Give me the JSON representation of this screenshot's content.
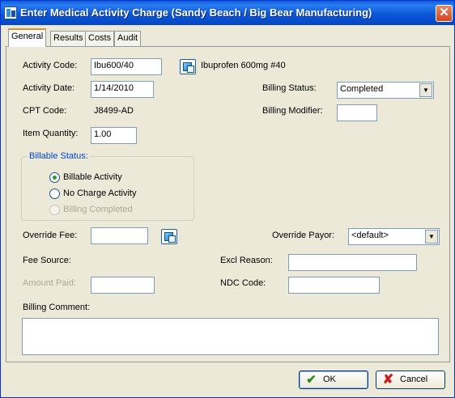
{
  "window": {
    "title": "Enter Medical Activity Charge (Sandy Beach / Big Bear Manufacturing)",
    "close_glyph": "✕"
  },
  "tabs": [
    {
      "label": "General",
      "active": true
    },
    {
      "label": "Results",
      "active": false
    },
    {
      "label": "Costs",
      "active": false
    },
    {
      "label": "Audit",
      "active": false
    }
  ],
  "general": {
    "activity_code_label": "Activity Code:",
    "activity_code_value": "Ibu600/40",
    "activity_code_description": "Ibuprofen 600mg #40",
    "activity_date_label": "Activity Date:",
    "activity_date_value": "1/14/2010",
    "cpt_code_label": "CPT Code:",
    "cpt_code_value": "J8499-AD",
    "item_quantity_label": "Item Quantity:",
    "item_quantity_value": "1.00",
    "billing_status_label": "Billing Status:",
    "billing_status_value": "Completed",
    "billing_modifier_label": "Billing Modifier:",
    "billing_modifier_value": "",
    "billable_status": {
      "title": "Billable Status:",
      "options": [
        {
          "label": "Billable Activity",
          "selected": true,
          "enabled": true
        },
        {
          "label": "No Charge Activity",
          "selected": false,
          "enabled": true
        },
        {
          "label": "Billing Completed",
          "selected": false,
          "enabled": false
        }
      ]
    },
    "override_fee_label": "Override Fee:",
    "override_fee_value": "",
    "override_payor_label": "Override Payor:",
    "override_payor_value": "<default>",
    "fee_source_label": "Fee Source:",
    "excl_reason_label": "Excl Reason:",
    "excl_reason_value": "",
    "amount_paid_label": "Amount Paid:",
    "amount_paid_value": "",
    "ndc_code_label": "NDC Code:",
    "ndc_code_value": "",
    "billing_comment_label": "Billing Comment:",
    "billing_comment_value": ""
  },
  "buttons": {
    "ok_label": "OK",
    "cancel_label": "Cancel"
  },
  "colors": {
    "title_bar": "#0b58d6",
    "group_title": "#0046d5",
    "selected_radio": "#21a121"
  },
  "icons": {
    "close": "close-icon",
    "activity_lookup": "lookup-icon",
    "fee_lookup": "lookup-icon",
    "ok": "checkmark-icon",
    "cancel": "x-icon"
  }
}
